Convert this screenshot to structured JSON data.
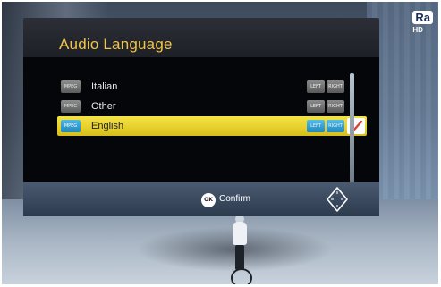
{
  "screen": {
    "brand": "Ra",
    "brand_sub": "HD "
  },
  "dialog": {
    "title": "Audio Language",
    "footer": {
      "ok_key": "OK",
      "confirm_label": "Confirm"
    },
    "tracks": [
      {
        "codec": "MPEG",
        "name": "Italian",
        "left": "LEFT",
        "right": "RIGHT",
        "selected": false
      },
      {
        "codec": "MPEG",
        "name": "Other",
        "left": "LEFT",
        "right": "RIGHT",
        "selected": false
      },
      {
        "codec": "MPEG",
        "name": "English",
        "left": "LEFT",
        "right": "RIGHT",
        "selected": true
      }
    ],
    "colors": {
      "title": "#f1c548",
      "highlight": "#e7d12c",
      "check": "#e23b3b"
    }
  }
}
